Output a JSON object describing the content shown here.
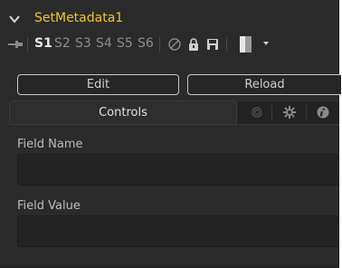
{
  "tool": {
    "title": "SetMetadata1"
  },
  "versions": [
    "S1",
    "S2",
    "S3",
    "S4",
    "S5",
    "S6"
  ],
  "active_version": "S1",
  "icons": {
    "collapse": "chevron-down-icon",
    "pin": "pin-icon",
    "disable": "no-entry-icon",
    "lock": "lock-icon",
    "save": "save-icon",
    "color": "color-swatch-icon",
    "dropdown": "triangle-down-icon",
    "tab_modifier": "modifier-icon",
    "tab_settings": "gear-icon",
    "tab_info": "info-icon"
  },
  "buttons": {
    "edit": "Edit",
    "reload": "Reload"
  },
  "tabs": {
    "controls": "Controls"
  },
  "fields": {
    "name": {
      "label": "Field Name",
      "value": ""
    },
    "value": {
      "label": "Field Value",
      "value": ""
    }
  },
  "colors": {
    "title": "#f0c528",
    "panel": "#2b2b2b",
    "field": "#232323"
  }
}
